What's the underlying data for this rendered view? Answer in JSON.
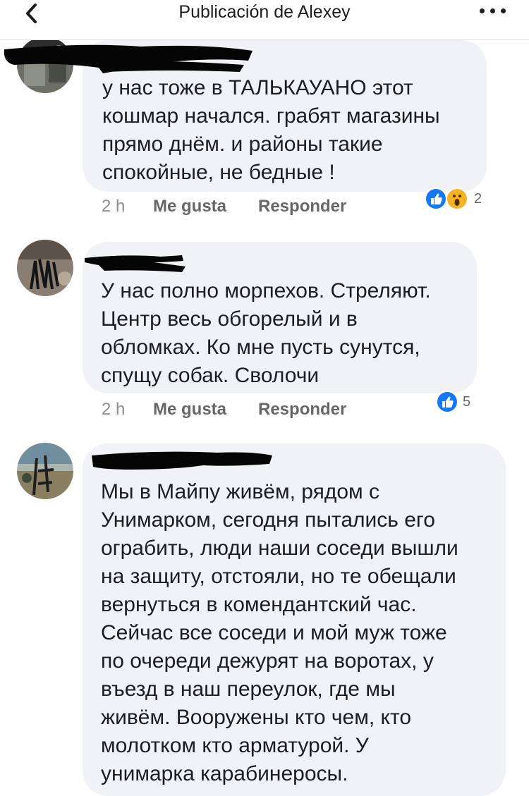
{
  "header": {
    "title": "Publicación de Alexey",
    "back_icon": "chevron-left-icon",
    "more_icon": "more-horizontal-icon"
  },
  "comments": [
    {
      "text": "у нас тоже в ТАЛЬКАУАНО этот\nкошмар начался. грабят магазины\nпрямо днём.  и районы такие\nспокойные, не бедные !",
      "time": "2 h",
      "like_label": "Me gusta",
      "reply_label": "Responder",
      "reactions": [
        "like",
        "wow"
      ],
      "reaction_count": "2"
    },
    {
      "text": "У нас полно морпехов. Стреляют.\nЦентр весь обгорелый и в\nобломках. Ко мне пусть сунутся,\nспущу собак. Сволочи",
      "time": "2 h",
      "like_label": "Me gusta",
      "reply_label": "Responder",
      "reactions": [
        "like"
      ],
      "reaction_count": "5"
    },
    {
      "text": "Мы в Майпу живём, рядом с\nУнимарком, сегодня пытались его\nограбить, люди наши соседи вышли\nна защиту, отстояли, но те обещали\nвернуться в комендантский час.\nСейчас все соседи и мой муж тоже\nпо очереди дежурят на воротах, у\nвъезд в наш переулок, где мы\nживём. Вооружены кто чем, кто\nмолотком кто арматурой. У\nунимарка карабинеросы."
    }
  ],
  "colors": {
    "bubble": "#f0f2f5",
    "like_blue": "#1877f2",
    "wow_yellow": "#f7b125",
    "meta_gray": "#65676b"
  }
}
